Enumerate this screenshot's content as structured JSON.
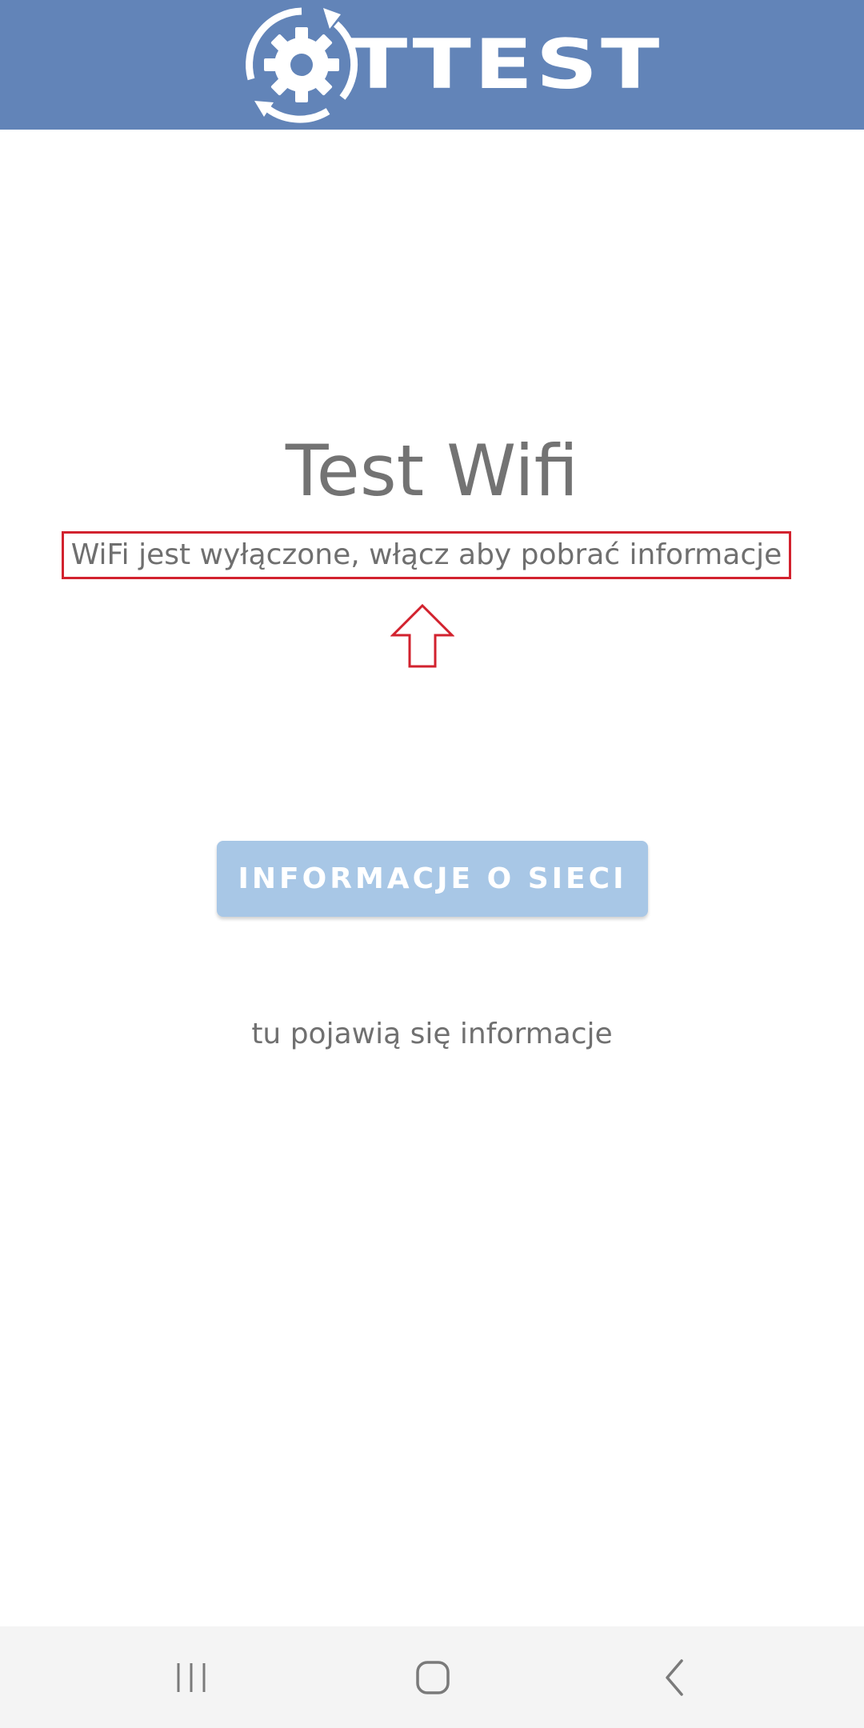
{
  "header": {
    "logo_text": "TTEST",
    "background_color": "#6284b8"
  },
  "main": {
    "title": "Test Wifi",
    "status_message": "WiFi jest wyłączone, włącz aby pobrać informacje",
    "highlight_color": "#d2222e",
    "network_button_label": "INFORMACJE O SIECI",
    "button_color": "#a8c7e6",
    "info_placeholder": "tu pojawią się informacje"
  },
  "navbar": {
    "recents_icon": "recents-icon",
    "home_icon": "home-icon",
    "back_icon": "back-icon"
  }
}
